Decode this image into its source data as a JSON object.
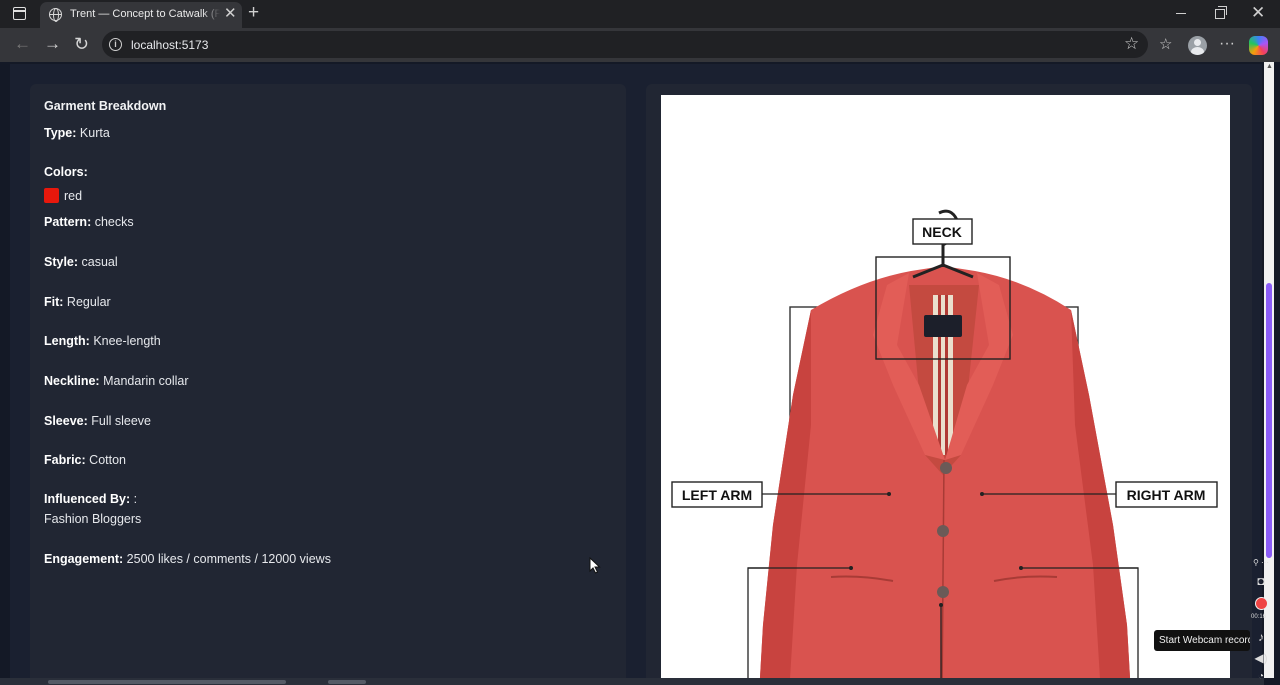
{
  "browser": {
    "tab_title": "Trent — Concept to Catwalk (PoC)",
    "url": "localhost:5173"
  },
  "breakdown": {
    "title": "Garment Breakdown",
    "type_label": "Type:",
    "type_value": "Kurta",
    "colors_label": "Colors:",
    "color_name": "red",
    "color_hex": "#e8180c",
    "pattern_label": "Pattern:",
    "pattern_value": "checks",
    "style_label": "Style:",
    "style_value": "casual",
    "fit_label": "Fit:",
    "fit_value": "Regular",
    "length_label": "Length:",
    "length_value": "Knee-length",
    "neckline_label": "Neckline:",
    "neckline_value": "Mandarin collar",
    "sleeve_label": "Sleeve:",
    "sleeve_value": "Full sleeve",
    "fabric_label": "Fabric:",
    "fabric_value": "Cotton",
    "influenced_label": "Influenced By:",
    "influenced_sep": ":",
    "influenced_value": "Fashion Bloggers",
    "engagement_label": "Engagement:",
    "engagement_value": "2500 likes / comments / 12000 views"
  },
  "annotations": {
    "neck": "NECK",
    "left_arm": "LEFT ARM",
    "right_arm": "RIGHT ARM"
  },
  "recorder": {
    "time": "00:16",
    "tooltip": "Start Webcam recording"
  }
}
